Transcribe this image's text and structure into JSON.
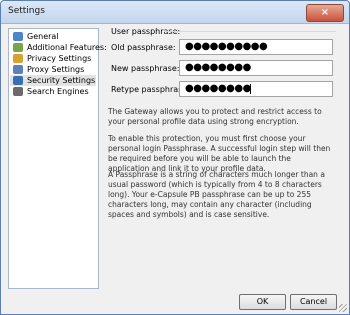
{
  "window": {
    "title": "Settings",
    "close_glyph": "×"
  },
  "nav": {
    "items": [
      {
        "label": "General",
        "icon": "general-icon",
        "color": "#4c86c6",
        "selected": false
      },
      {
        "label": "Additional Features:",
        "icon": "features-icon",
        "color": "#7aa34a",
        "selected": false
      },
      {
        "label": "Privacy Settings",
        "icon": "lock-icon",
        "color": "#d6a331",
        "selected": false
      },
      {
        "label": "Proxy Settings",
        "icon": "proxy-icon",
        "color": "#5f7fb9",
        "selected": false
      },
      {
        "label": "Security Settings",
        "icon": "shield-icon",
        "color": "#3a6fb5",
        "selected": true
      },
      {
        "label": "Search Engines",
        "icon": "search-icon",
        "color": "#6b6b6b",
        "selected": false
      }
    ]
  },
  "security": {
    "section_title": "User passphrase:",
    "old_label": "Old passphrase:",
    "old_value": "●●●●●●●●●●",
    "new_label": "New passphrase:",
    "new_value": "●●●●●●●●",
    "retype_label": "Retype passphrase:",
    "retype_value": "●●●●●●●●"
  },
  "description": {
    "p1": "The Gateway allows you to protect and restrict access to your personal profile data using strong encryption.",
    "p2": "To enable this protection, you must first choose your personal login Passphrase. A successful login step will then be required before you will be able to launch the application and link it to your profile data.",
    "p3": "A Passphrase is a string of characters much longer than a usual password (which is typically from 4 to 8 characters long). Your e-Capsule PB passphrase can be up to 255 characters long, may contain any character (including spaces and symbols) and is case sensitive."
  },
  "buttons": {
    "ok": "OK",
    "cancel": "Cancel"
  }
}
